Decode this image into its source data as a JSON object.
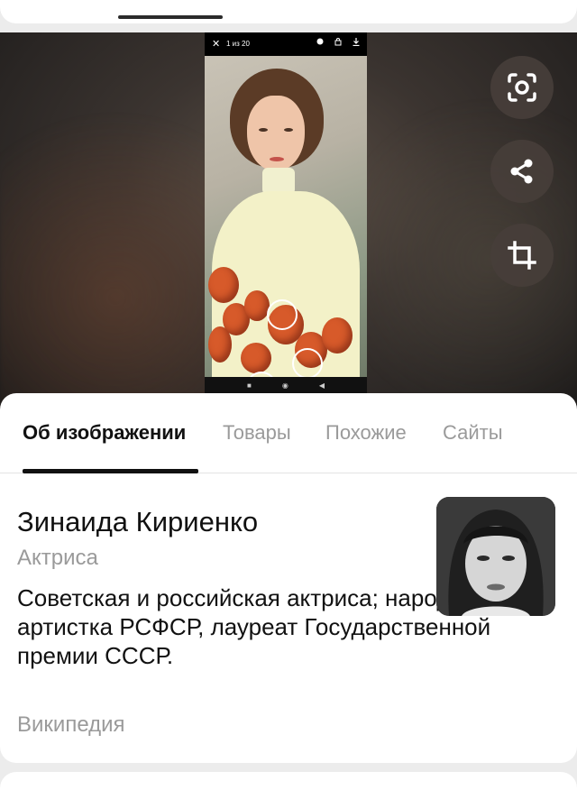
{
  "viewer": {
    "phone_topbar": {
      "close_glyph": "✕",
      "counter": "1 из 20"
    },
    "side_buttons": [
      {
        "name": "lens-search-button",
        "icon": "lens-scan-icon"
      },
      {
        "name": "share-button",
        "icon": "share-icon"
      },
      {
        "name": "crop-button",
        "icon": "crop-icon"
      }
    ],
    "phone_nav": {
      "square": "■",
      "circle": "◉",
      "back": "◀"
    }
  },
  "tabs": [
    {
      "label": "Об изображении",
      "active": true
    },
    {
      "label": "Товары",
      "active": false
    },
    {
      "label": "Похожие",
      "active": false
    },
    {
      "label": "Сайты",
      "active": false
    }
  ],
  "entity": {
    "name": "Зинаида Кириенко",
    "type": "Актриса",
    "description": "Советская и российская актриса; народная артистка РСФСР, лауреат Государственной премии СССР.",
    "source": "Википедия"
  },
  "colors": {
    "accent_text": "#111111",
    "muted_text": "#9a9a9a",
    "button_bg": "#463e3a"
  }
}
